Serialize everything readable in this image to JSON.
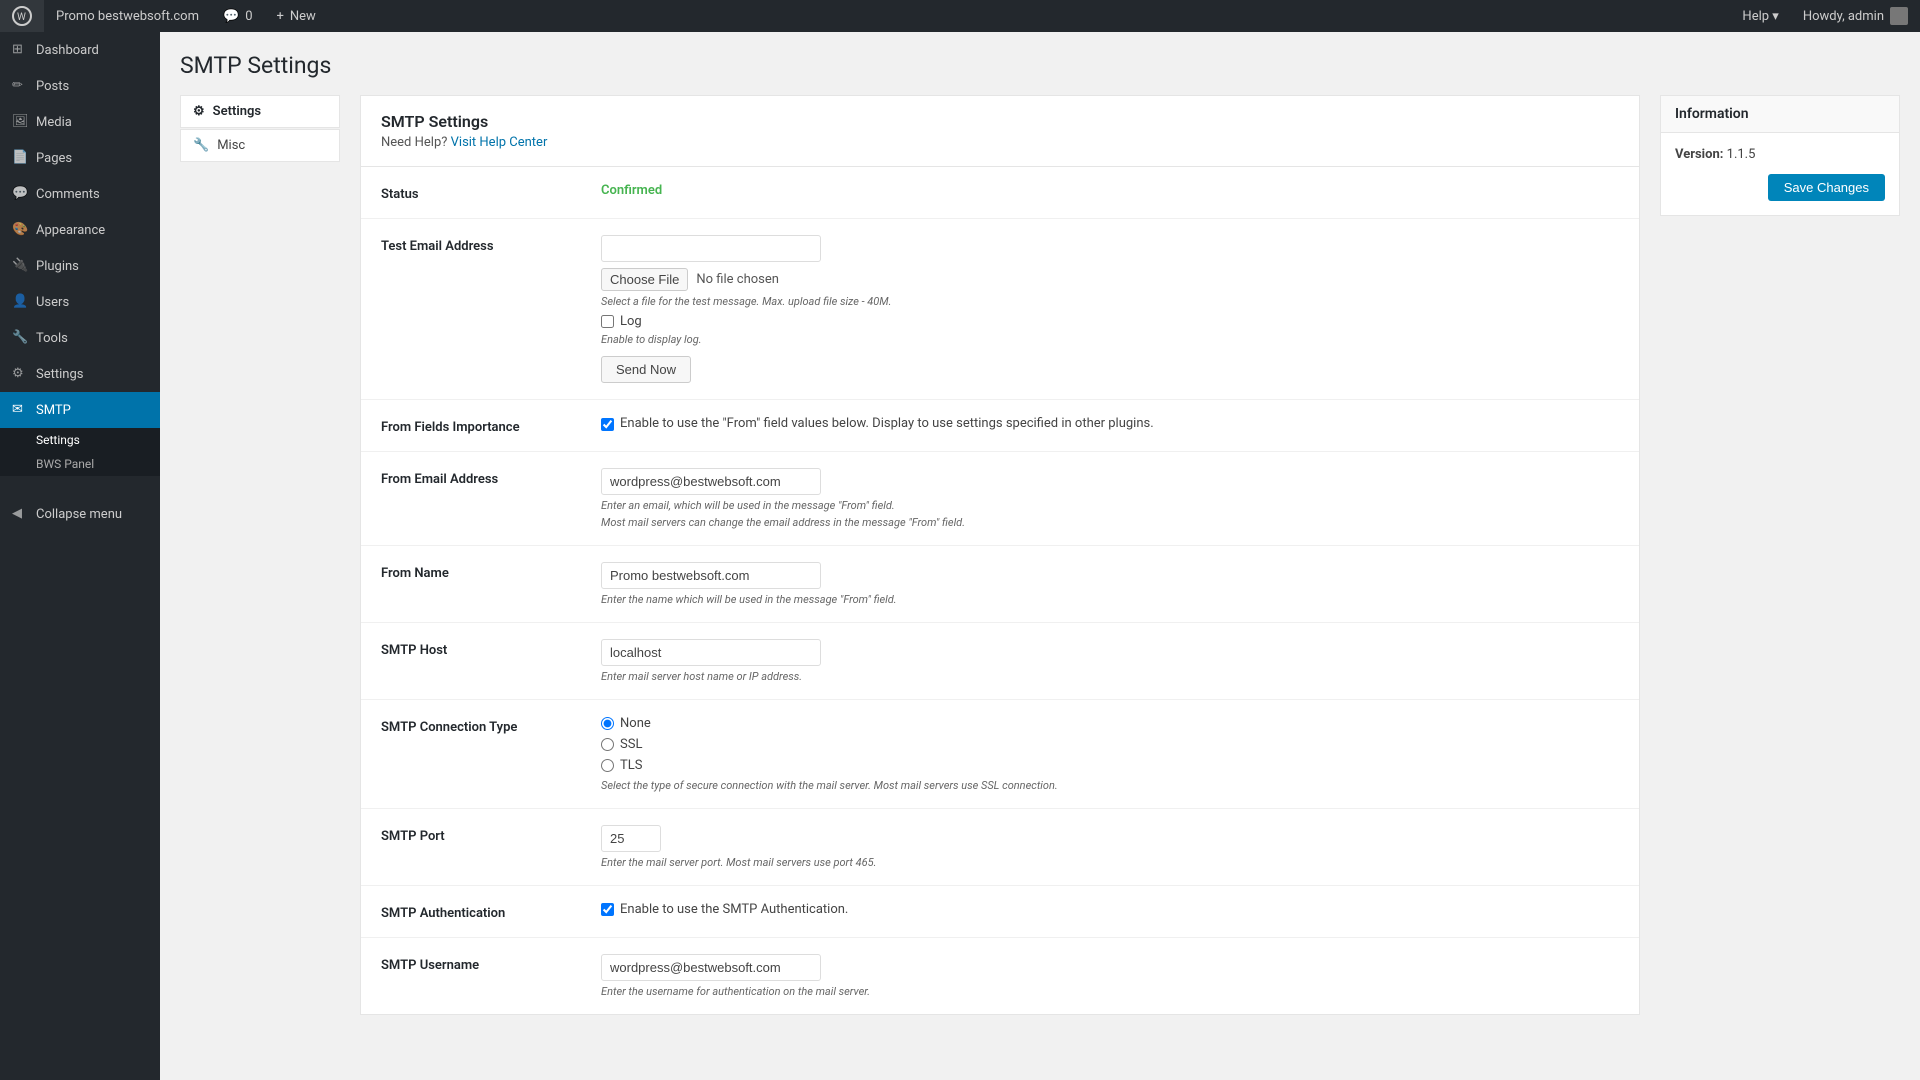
{
  "adminbar": {
    "site_name": "Promo bestwebsoft.com",
    "new_label": "New",
    "comments_count": "0",
    "howdy": "Howdy, admin",
    "help_label": "Help ▾"
  },
  "sidebar": {
    "items": [
      {
        "id": "dashboard",
        "label": "Dashboard",
        "icon": "⊞"
      },
      {
        "id": "posts",
        "label": "Posts",
        "icon": "📝"
      },
      {
        "id": "media",
        "label": "Media",
        "icon": "🖼"
      },
      {
        "id": "pages",
        "label": "Pages",
        "icon": "📄"
      },
      {
        "id": "comments",
        "label": "Comments",
        "icon": "💬"
      },
      {
        "id": "appearance",
        "label": "Appearance",
        "icon": "🎨"
      },
      {
        "id": "plugins",
        "label": "Plugins",
        "icon": "🔌"
      },
      {
        "id": "users",
        "label": "Users",
        "icon": "👤"
      },
      {
        "id": "tools",
        "label": "Tools",
        "icon": "🔧"
      },
      {
        "id": "settings",
        "label": "Settings",
        "icon": "⚙"
      },
      {
        "id": "smtp",
        "label": "SMTP",
        "icon": "✉",
        "active": true
      }
    ],
    "smtp_sub": [
      {
        "id": "settings-sub",
        "label": "Settings",
        "active": true
      },
      {
        "id": "bws-panel",
        "label": "BWS Panel"
      }
    ],
    "collapse_label": "Collapse menu"
  },
  "sub_nav": {
    "items": [
      {
        "id": "smtp-settings",
        "label": "Settings",
        "icon": "⚙",
        "active": true
      },
      {
        "id": "misc",
        "label": "Misc",
        "icon": "🔧"
      }
    ]
  },
  "page": {
    "title": "SMTP Settings"
  },
  "card": {
    "title": "SMTP Settings",
    "need_help_text": "Need Help?",
    "visit_help_center": "Visit Help Center",
    "fields": {
      "status": {
        "label": "Status",
        "value": "Confirmed"
      },
      "test_email": {
        "label": "Test Email Address",
        "value": "",
        "placeholder": "",
        "choose_file_label": "Choose File",
        "no_file_text": "No file chosen",
        "file_hint": "Select a file for the test message. Max. upload file size - 40M.",
        "log_label": "Log",
        "log_hint": "Enable to display log.",
        "send_now_label": "Send Now"
      },
      "from_fields_importance": {
        "label": "From Fields Importance",
        "hint": "Enable to use the \"From\" field values below. Display to use settings specified in other plugins.",
        "checked": true
      },
      "from_email": {
        "label": "From Email Address",
        "value": "wordpress@bestwebsoft.com",
        "hint1": "Enter an email, which will be used in the message \"From\" field.",
        "hint2": "Most mail servers can change the email address in the message \"From\" field."
      },
      "from_name": {
        "label": "From Name",
        "value": "Promo bestwebsoft.com",
        "hint": "Enter the name which will be used in the message \"From\" field."
      },
      "smtp_host": {
        "label": "SMTP Host",
        "value": "localhost",
        "hint": "Enter mail server host name or IP address."
      },
      "smtp_connection_type": {
        "label": "SMTP Connection Type",
        "options": [
          {
            "value": "none",
            "label": "None",
            "checked": true
          },
          {
            "value": "ssl",
            "label": "SSL",
            "checked": false
          },
          {
            "value": "tls",
            "label": "TLS",
            "checked": false
          }
        ],
        "hint": "Select the type of secure connection with the mail server. Most mail servers use SSL connection."
      },
      "smtp_port": {
        "label": "SMTP Port",
        "value": "25",
        "hint": "Enter the mail server port. Most mail servers use port 465."
      },
      "smtp_auth": {
        "label": "SMTP Authentication",
        "checked": true,
        "hint": "Enable to use the SMTP Authentication."
      },
      "smtp_username": {
        "label": "SMTP Username",
        "value": "wordpress@bestwebsoft.com",
        "hint": "Enter the username for authentication on the mail server."
      }
    }
  },
  "info_panel": {
    "title": "Information",
    "version_label": "Version:",
    "version_value": "1.1.5",
    "save_label": "Save Changes"
  }
}
